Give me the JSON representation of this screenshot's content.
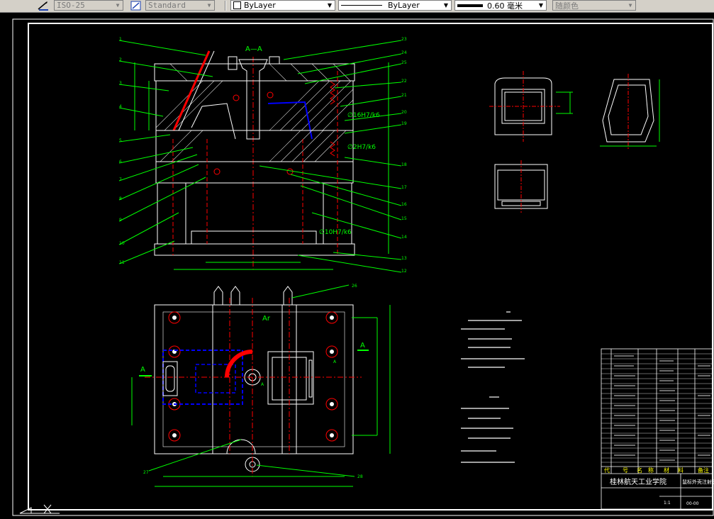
{
  "toolbar": {
    "dimstyle": "ISO-25",
    "textstyle": "Standard",
    "color": "ByLayer",
    "linetype": "ByLayer",
    "lineweight": "0.60 毫米",
    "plotstyle": "随颜色"
  },
  "drawing": {
    "section_label": "A—A",
    "view_a_label": "A",
    "view_a_label2": "Ar",
    "view_a_small": "A",
    "fit1": "∅16H7/k6",
    "fit2": "∅2H7/k6",
    "fit3": "∅10H7/k6",
    "callouts_left": [
      "1",
      "2",
      "3",
      "4",
      "5",
      "6",
      "7",
      "8",
      "9",
      "10",
      "11"
    ],
    "callouts_right": [
      "23",
      "24",
      "25",
      "22",
      "21",
      "20",
      "19",
      "18",
      "17",
      "16",
      "15",
      "14",
      "13",
      "12"
    ],
    "callout_26": "26",
    "callout_27": "27",
    "callout_28": "28"
  },
  "title_block": {
    "school": "桂林航天工业学院",
    "drawing_name": "鼠标外壳注射模装配图",
    "drawing_no": "00-00",
    "header_cols": [
      "代",
      "号",
      "名",
      "称",
      "材",
      "料",
      "备注"
    ],
    "label_scale": "1:1"
  },
  "colors": {
    "green": "#00ff00",
    "red": "#ff0000",
    "blue": "#0000ff",
    "white": "#ffffff",
    "yellow": "#ffff00"
  }
}
